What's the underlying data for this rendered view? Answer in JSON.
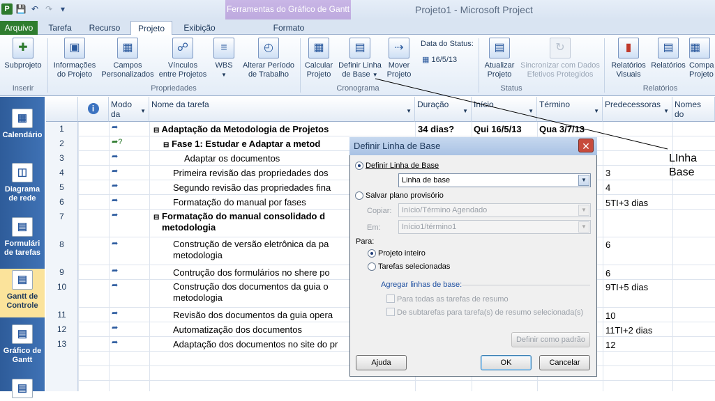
{
  "window": {
    "title": "Projeto1  -  Microsoft Project",
    "context_tab_group": "Ferramentas do Gráfico de Gantt"
  },
  "tabs": [
    "Arquivo",
    "Tarefa",
    "Recurso",
    "Projeto",
    "Exibição",
    "Formato"
  ],
  "active_tab": "Projeto",
  "ribbon": {
    "buttons": {
      "subprojeto": "Subprojeto",
      "info1": "Informações",
      "info2": "do Projeto",
      "campos1": "Campos",
      "campos2": "Personalizados",
      "vinc1": "Vínculos",
      "vinc2": "entre Projetos",
      "wbs": "WBS",
      "alt1": "Alterar Período",
      "alt2": "de Trabalho",
      "calc1": "Calcular",
      "calc2": "Projeto",
      "def1": "Definir Linha",
      "def2": "de Base",
      "mov1": "Mover",
      "mov2": "Projeto",
      "status_date_label": "Data do Status:",
      "status_date_value": "16/5/13",
      "atu1": "Atualizar",
      "atu2": "Projeto",
      "sinc1": "Sincronizar com Dados",
      "sinc2": "Efetivos Protegidos",
      "relv1": "Relatórios",
      "relv2": "Visuais",
      "rel": "Relatórios",
      "comp1": "Compa",
      "comp2": "Projeto"
    },
    "groups": {
      "inserir": "Inserir",
      "propriedades": "Propriedades",
      "cronograma": "Cronograma",
      "status": "Status",
      "relatorios": "Relatórios"
    }
  },
  "left_views": [
    "Calendário",
    "Diagrama de rede",
    "Formulári de tarefas",
    "Gantt de Controle",
    "Gráfico de Gantt"
  ],
  "columns": {
    "modo": "Modo da",
    "nome": "Nome da tarefa",
    "duracao": "Duração",
    "inicio": "Início",
    "termino": "Término",
    "pred": "Predecessoras",
    "recursos": "Nomes do"
  },
  "rows": [
    {
      "id": "1",
      "name": "Adaptação da Metodologia de Projetos",
      "dur": "34 dias?",
      "start": "Qui 16/5/13",
      "end": "Qua 3/7/13",
      "pred": ""
    },
    {
      "id": "2",
      "name": "Fase 1: Estudar e Adaptar a  metod",
      "dur": "",
      "start": "",
      "end": "",
      "pred": ""
    },
    {
      "id": "3",
      "name": "Adaptar os documentos",
      "dur": "",
      "start": "",
      "end": "",
      "pred": ""
    },
    {
      "id": "4",
      "name": "Primeira revisão das propriedades dos",
      "dur": "",
      "start": "",
      "end": "",
      "pred": "3"
    },
    {
      "id": "5",
      "name": "Segundo revisão das propriedades fina",
      "dur": "",
      "start": "",
      "end": "",
      "pred": "4"
    },
    {
      "id": "6",
      "name": "Formatação do manual por fases",
      "dur": "",
      "start": "",
      "end": "",
      "pred": "5TI+3 dias"
    },
    {
      "id": "7",
      "name": "Formatação do manual consolidado d",
      "name2": "metodologia",
      "dur": "",
      "start": "",
      "end": "",
      "pred": ""
    },
    {
      "id": "8",
      "name": "Construção de versão eletrônica da pa",
      "name2": "metodologia",
      "dur": "",
      "start": "",
      "end": "",
      "pred": "6"
    },
    {
      "id": "9",
      "name": "Contrução dos formulários no shere po",
      "dur": "",
      "start": "",
      "end": "",
      "pred": "6"
    },
    {
      "id": "10",
      "name": "Construção dos documentos da guia o",
      "name2": "metodologia",
      "dur": "",
      "start": "",
      "end": "",
      "pred": "9TI+5 dias"
    },
    {
      "id": "11",
      "name": "Revisão dos documentos da guia opera",
      "dur": "",
      "start": "",
      "end": "",
      "pred": "10"
    },
    {
      "id": "12",
      "name": "Automatização dos documentos",
      "dur": "",
      "start": "",
      "end": "",
      "pred": "11TI+2 dias"
    },
    {
      "id": "13",
      "name": "Adaptação dos documentos no site do pr",
      "dur": "",
      "start": "",
      "end": "",
      "pred": "12"
    }
  ],
  "dialog": {
    "title": "Definir Linha de Base",
    "opt_definir": "Definir Linha de Base",
    "baseline_select": "Linha de base",
    "opt_salvar": "Salvar plano provisório",
    "copiar_label": "Copiar:",
    "copiar_value": "Início/Término Agendado",
    "em_label": "Em:",
    "em_value": "Início1/término1",
    "para_label": "Para:",
    "opt_projeto": "Projeto inteiro",
    "opt_tarefas": "Tarefas selecionadas",
    "agregar_label": "Agregar linhas de base:",
    "chk_resumo": "Para todas as tarefas de resumo",
    "chk_subtarefas": "De subtarefas para tarefa(s) de resumo selecionada(s)",
    "btn_padrao": "Definir como padrão",
    "btn_ajuda": "Ajuda",
    "btn_ok": "OK",
    "btn_cancelar": "Cancelar"
  },
  "annotation": {
    "line1": "LInha",
    "line2": "Base"
  }
}
